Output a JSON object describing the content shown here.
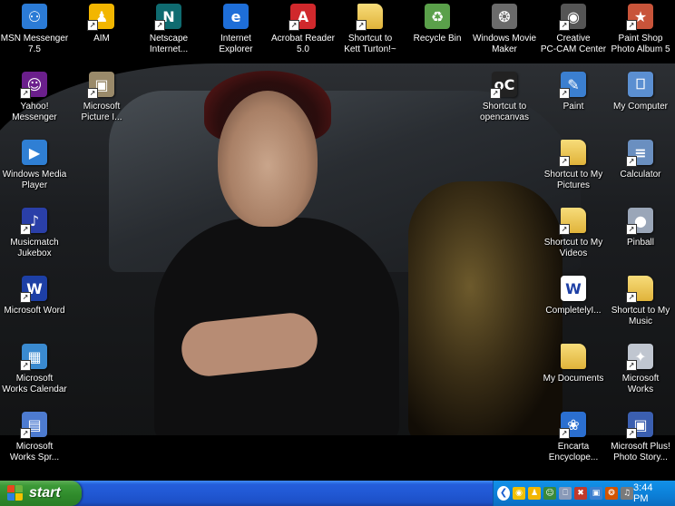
{
  "desktop": {
    "icons": [
      {
        "label": "MSN Messenger\n7.5",
        "icon": "msn-messenger-icon",
        "color": "#2b7bd6",
        "glyph": "⚇",
        "shortcut": false
      },
      {
        "label": "AIM",
        "icon": "aim-icon",
        "color": "#f2b600",
        "glyph": "♟",
        "shortcut": true
      },
      {
        "label": "Netscape\nInternet...",
        "icon": "netscape-icon",
        "color": "#0f6b70",
        "glyph": "N",
        "shortcut": true
      },
      {
        "label": "Internet\nExplorer",
        "icon": "internet-explorer-icon",
        "color": "#1e6ed8",
        "glyph": "e",
        "shortcut": false
      },
      {
        "label": "Acrobat Reader\n5.0",
        "icon": "acrobat-icon",
        "color": "#d0282c",
        "glyph": "A",
        "shortcut": true
      },
      {
        "label": "Shortcut to\nKett Turton!~",
        "icon": "folder-icon",
        "color": "#f0cc5a",
        "glyph": "",
        "shortcut": true
      },
      {
        "label": "Recycle Bin",
        "icon": "recycle-bin-icon",
        "color": "#5aa04a",
        "glyph": "♻",
        "shortcut": false
      },
      {
        "label": "Windows Movie\nMaker",
        "icon": "movie-maker-icon",
        "color": "#6b6b6b",
        "glyph": "❂",
        "shortcut": false
      },
      {
        "label": "Creative\nPC-CAM Center",
        "icon": "pc-cam-icon",
        "color": "#555555",
        "glyph": "◉",
        "shortcut": true
      },
      {
        "label": "Paint Shop\nPhoto Album 5",
        "icon": "paint-shop-icon",
        "color": "#c8543a",
        "glyph": "★",
        "shortcut": true
      },
      {
        "label": "Yahoo!\nMessenger",
        "icon": "yahoo-messenger-icon",
        "color": "#6b1f8c",
        "glyph": "☺",
        "shortcut": true
      },
      {
        "label": "Microsoft\nPicture I...",
        "icon": "picture-it-icon",
        "color": "#9a8a6a",
        "glyph": "▣",
        "shortcut": true
      },
      {
        "label": "Windows Media\nPlayer",
        "icon": "media-player-icon",
        "color": "#2f7fd4",
        "glyph": "▶",
        "shortcut": false
      },
      {
        "label": "Musicmatch\nJukebox",
        "icon": "musicmatch-icon",
        "color": "#2a3fa8",
        "glyph": "♪",
        "shortcut": true
      },
      {
        "label": "Microsoft Word",
        "icon": "word-icon",
        "color": "#1d3fa5",
        "glyph": "W",
        "shortcut": true
      },
      {
        "label": "Microsoft\nWorks Calendar",
        "icon": "works-calendar-icon",
        "color": "#3a8ad0",
        "glyph": "▦",
        "shortcut": true
      },
      {
        "label": "Microsoft\nWorks Spr...",
        "icon": "works-spreadsheet-icon",
        "color": "#4d7bd0",
        "glyph": "▤",
        "shortcut": true
      },
      {
        "label": "Shortcut to\nopencanvas",
        "icon": "opencanvas-icon",
        "color": "#222222",
        "glyph": "oC",
        "shortcut": true
      },
      {
        "label": "Paint",
        "icon": "paint-icon",
        "color": "#3b7fd0",
        "glyph": "✎",
        "shortcut": true
      },
      {
        "label": "My Computer",
        "icon": "my-computer-icon",
        "color": "#5b8fd1",
        "glyph": "⎕",
        "shortcut": false
      },
      {
        "label": "Shortcut to My\nPictures",
        "icon": "my-pictures-icon",
        "color": "#f0cc5a",
        "glyph": "",
        "shortcut": true
      },
      {
        "label": "Calculator",
        "icon": "calculator-icon",
        "color": "#6a8fc0",
        "glyph": "≡",
        "shortcut": true
      },
      {
        "label": "Shortcut to My\nVideos",
        "icon": "my-videos-icon",
        "color": "#f0cc5a",
        "glyph": "",
        "shortcut": true
      },
      {
        "label": "Pinball",
        "icon": "pinball-icon",
        "color": "#9aa6b8",
        "glyph": "●",
        "shortcut": true
      },
      {
        "label": "CompletelyI...",
        "icon": "word-document-icon",
        "color": "#ffffff",
        "glyph": "W",
        "shortcut": false
      },
      {
        "label": "Shortcut to My\nMusic",
        "icon": "my-music-icon",
        "color": "#f0cc5a",
        "glyph": "",
        "shortcut": true
      },
      {
        "label": "My Documents",
        "icon": "my-documents-icon",
        "color": "#f0cc5a",
        "glyph": "",
        "shortcut": false
      },
      {
        "label": "Microsoft\nWorks",
        "icon": "works-icon",
        "color": "#c0c6d0",
        "glyph": "✦",
        "shortcut": true
      },
      {
        "label": "Encarta\nEncyclope...",
        "icon": "encarta-icon",
        "color": "#2b6fd0",
        "glyph": "❀",
        "shortcut": true
      },
      {
        "label": "Microsoft Plus!\nPhoto Story...",
        "icon": "photo-story-icon",
        "color": "#3b5fb0",
        "glyph": "▣",
        "shortcut": true
      }
    ]
  },
  "taskbar": {
    "start_label": "start",
    "clock": "3:44 PM",
    "tray_icons": [
      {
        "icon": "tray-norton-icon",
        "color": "#f2c000",
        "glyph": "◉"
      },
      {
        "icon": "tray-aim-icon",
        "color": "#f2b600",
        "glyph": "♟"
      },
      {
        "icon": "tray-messenger-icon",
        "color": "#3a8a3a",
        "glyph": "☺"
      },
      {
        "icon": "tray-network-icon",
        "color": "#8a9ab8",
        "glyph": "⎕"
      },
      {
        "icon": "tray-shield-icon",
        "color": "#c0392b",
        "glyph": "✖"
      },
      {
        "icon": "tray-display-icon",
        "color": "#3b7fd0",
        "glyph": "▣"
      },
      {
        "icon": "tray-antivirus-icon",
        "color": "#d35400",
        "glyph": "❂"
      },
      {
        "icon": "tray-volume-icon",
        "color": "#7a7a7a",
        "glyph": "♫"
      }
    ]
  }
}
